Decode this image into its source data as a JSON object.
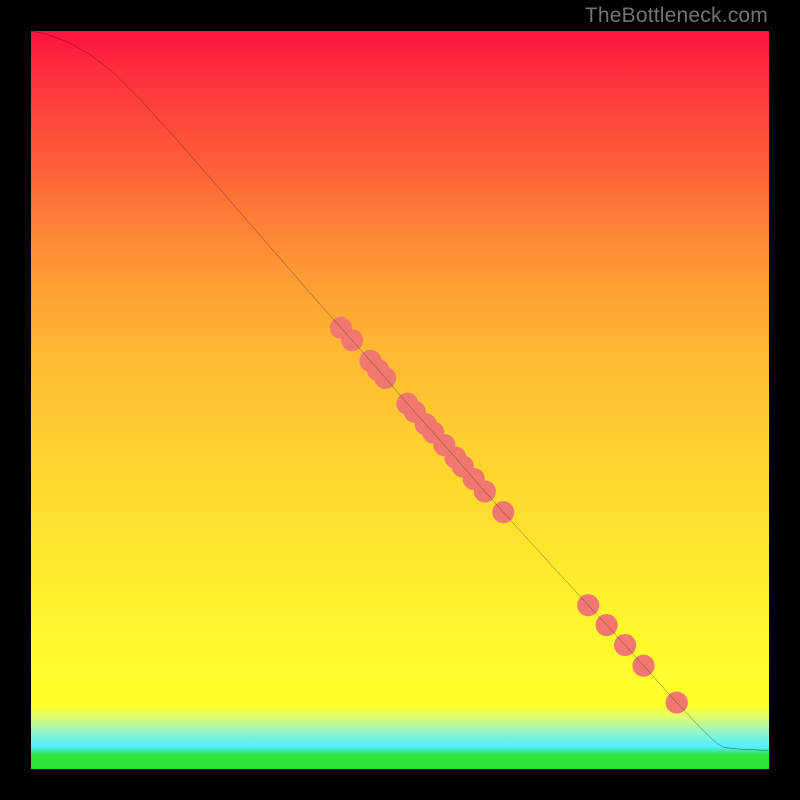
{
  "watermark": "TheBottleneck.com",
  "chart_data": {
    "type": "line",
    "title": "",
    "xlabel": "",
    "ylabel": "",
    "xlim": [
      0,
      100
    ],
    "ylim": [
      0,
      100
    ],
    "curve": [
      {
        "x": 0.0,
        "y": 100.0
      },
      {
        "x": 2.0,
        "y": 99.6
      },
      {
        "x": 5.0,
        "y": 98.5
      },
      {
        "x": 8.0,
        "y": 96.8
      },
      {
        "x": 11.0,
        "y": 94.5
      },
      {
        "x": 15.0,
        "y": 90.5
      },
      {
        "x": 20.0,
        "y": 85.0
      },
      {
        "x": 30.0,
        "y": 73.5
      },
      {
        "x": 40.0,
        "y": 62.0
      },
      {
        "x": 42.0,
        "y": 59.8
      },
      {
        "x": 46.0,
        "y": 55.3
      },
      {
        "x": 48.0,
        "y": 53.0
      },
      {
        "x": 51.0,
        "y": 49.5
      },
      {
        "x": 53.5,
        "y": 46.7
      },
      {
        "x": 57.5,
        "y": 42.2
      },
      {
        "x": 60.0,
        "y": 39.3
      },
      {
        "x": 64.0,
        "y": 34.8
      },
      {
        "x": 70.0,
        "y": 28.2
      },
      {
        "x": 75.5,
        "y": 22.2
      },
      {
        "x": 78.0,
        "y": 19.5
      },
      {
        "x": 80.5,
        "y": 16.8
      },
      {
        "x": 83.0,
        "y": 14.0
      },
      {
        "x": 87.5,
        "y": 9.0
      },
      {
        "x": 91.0,
        "y": 5.3
      },
      {
        "x": 93.0,
        "y": 3.4
      },
      {
        "x": 94.0,
        "y": 2.9
      },
      {
        "x": 96.0,
        "y": 2.7
      },
      {
        "x": 100.0,
        "y": 2.5
      }
    ],
    "markers": [
      {
        "x": 42.0,
        "y": 59.8
      },
      {
        "x": 43.5,
        "y": 58.1
      },
      {
        "x": 46.0,
        "y": 55.3
      },
      {
        "x": 47.0,
        "y": 54.1
      },
      {
        "x": 48.0,
        "y": 53.0
      },
      {
        "x": 51.0,
        "y": 49.5
      },
      {
        "x": 52.0,
        "y": 48.4
      },
      {
        "x": 53.5,
        "y": 46.7
      },
      {
        "x": 54.5,
        "y": 45.6
      },
      {
        "x": 56.0,
        "y": 43.9
      },
      {
        "x": 57.5,
        "y": 42.2
      },
      {
        "x": 58.5,
        "y": 41.0
      },
      {
        "x": 60.0,
        "y": 39.3
      },
      {
        "x": 61.5,
        "y": 37.6
      },
      {
        "x": 64.0,
        "y": 34.8
      },
      {
        "x": 75.5,
        "y": 22.2
      },
      {
        "x": 78.0,
        "y": 19.5
      },
      {
        "x": 80.5,
        "y": 16.8
      },
      {
        "x": 83.0,
        "y": 14.0
      },
      {
        "x": 87.5,
        "y": 9.0
      }
    ],
    "marker_radius_pct": 1.5,
    "marker_color": "#f07870",
    "grid": false
  }
}
